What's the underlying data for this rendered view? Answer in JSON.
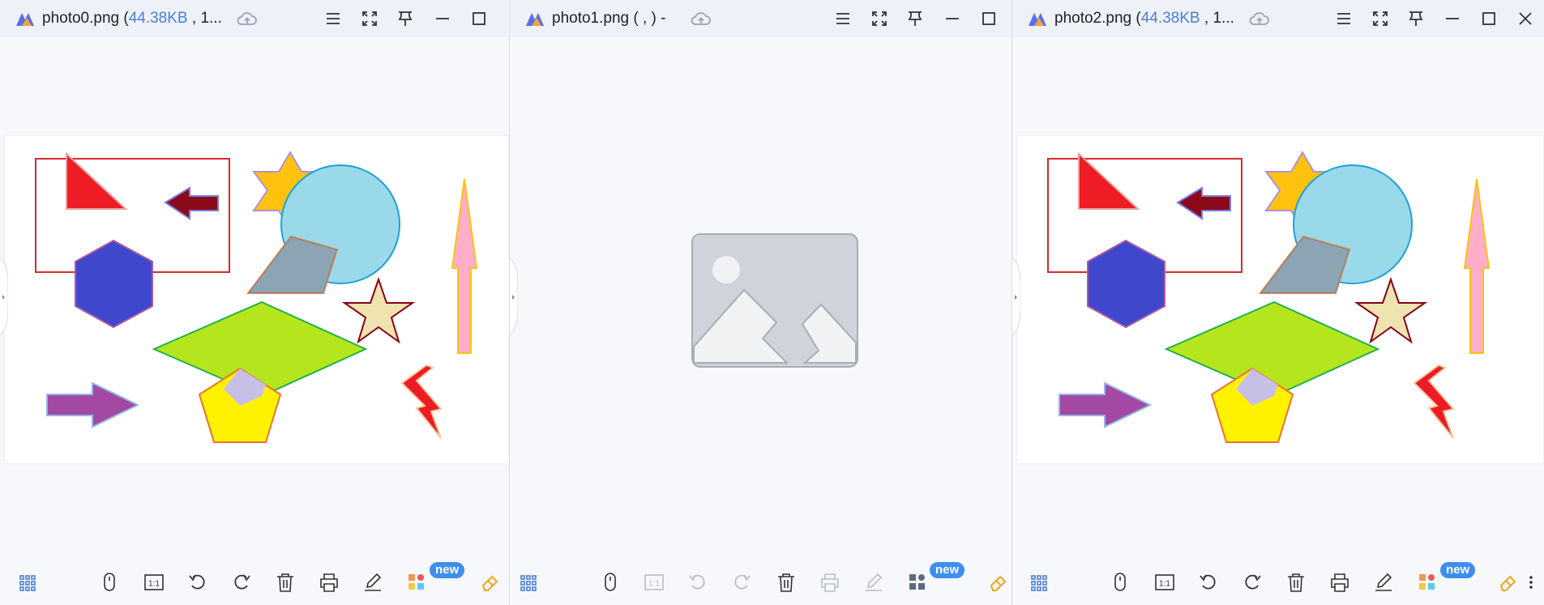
{
  "panes": [
    {
      "file_name": "photo0.png (",
      "file_size": "44.38KB",
      "file_rest": " , 1..."
    },
    {
      "file_name": "photo1.png ( , ) -",
      "file_size": "",
      "file_rest": ""
    },
    {
      "file_name": "photo2.png (",
      "file_size": "44.38KB",
      "file_rest": " , 1..."
    }
  ],
  "toolbar": {
    "new_badge": "new",
    "actual_size_label": "1:1"
  },
  "icons": {
    "titlebar": [
      "app-logo-icon",
      "cloud-upload-icon",
      "menu-icon",
      "fullscreen-icon",
      "pin-icon",
      "minimize-icon",
      "maximize-icon",
      "close-icon"
    ],
    "bottombar": [
      "grid-icon",
      "mouse-icon",
      "actual-size-icon",
      "rotate-left-icon",
      "rotate-right-icon",
      "delete-icon",
      "print-icon",
      "edit-icon",
      "apps-icon",
      "eraser-icon",
      "more-icon"
    ]
  },
  "colors": {
    "accent": "#4a7fd6",
    "badge": "#3d8ef0",
    "titlebar_bg": "#eef1f8"
  }
}
